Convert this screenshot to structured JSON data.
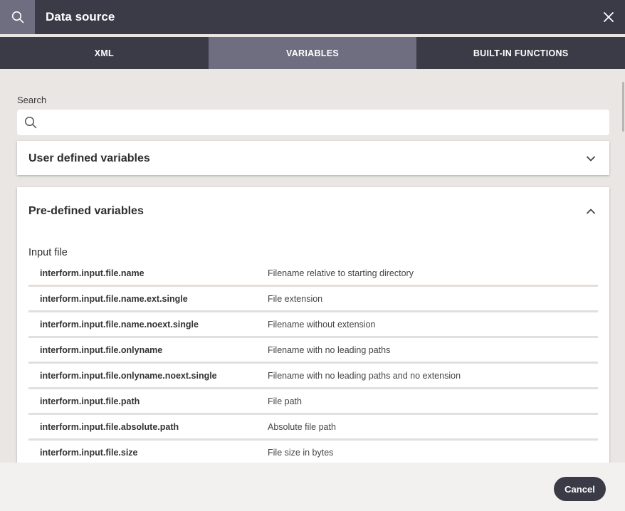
{
  "header": {
    "title": "Data source",
    "search_icon": "search-icon",
    "close_icon": "close-icon"
  },
  "tabs": [
    {
      "label": "XML",
      "active": false
    },
    {
      "label": "VARIABLES",
      "active": true
    },
    {
      "label": "BUILT-IN FUNCTIONS",
      "active": false
    }
  ],
  "search": {
    "label": "Search",
    "value": "",
    "placeholder": ""
  },
  "user_defined": {
    "title": "User defined variables",
    "expanded": false,
    "icon": "chevron-down-icon"
  },
  "predefined": {
    "title": "Pre-defined variables",
    "expanded": true,
    "icon": "chevron-up-icon",
    "section_title": "Input file",
    "rows": [
      {
        "name": "interform.input.file.name",
        "desc": "Filename relative to starting directory"
      },
      {
        "name": "interform.input.file.name.ext.single",
        "desc": "File extension"
      },
      {
        "name": "interform.input.file.name.noext.single",
        "desc": "Filename without extension"
      },
      {
        "name": "interform.input.file.onlyname",
        "desc": "Filename with no leading paths"
      },
      {
        "name": "interform.input.file.onlyname.noext.single",
        "desc": "Filename with no leading paths and no extension"
      },
      {
        "name": "interform.input.file.path",
        "desc": "File path"
      },
      {
        "name": "interform.input.file.absolute.path",
        "desc": "Absolute file path"
      },
      {
        "name": "interform.input.file.size",
        "desc": "File size in bytes"
      }
    ]
  },
  "footer": {
    "cancel_label": "Cancel"
  },
  "colors": {
    "header_bg": "#3b3a47",
    "active_tab_bg": "#6f6e80",
    "page_bg": "#e9e6e3",
    "footer_bg": "#f3f1ef"
  }
}
